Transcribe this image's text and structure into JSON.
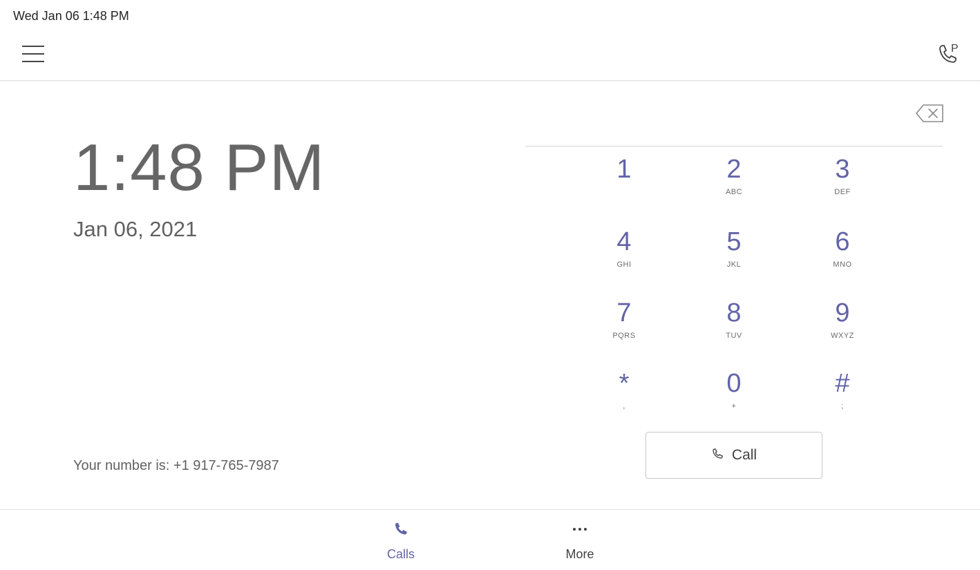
{
  "status_bar": {
    "datetime": "Wed Jan 06  1:48 PM"
  },
  "header": {
    "menu_icon": "hamburger-menu-icon",
    "park_icon": "call-park-icon"
  },
  "clock": {
    "time": "1:48 PM",
    "date": "Jan 06, 2021",
    "my_number": "Your number is: +1 917-765-7987"
  },
  "dialpad": {
    "backspace_icon": "backspace-icon",
    "keys": [
      {
        "digit": "1",
        "letters": ""
      },
      {
        "digit": "2",
        "letters": "ABC"
      },
      {
        "digit": "3",
        "letters": "DEF"
      },
      {
        "digit": "4",
        "letters": "GHI"
      },
      {
        "digit": "5",
        "letters": "JKL"
      },
      {
        "digit": "6",
        "letters": "MNO"
      },
      {
        "digit": "7",
        "letters": "PQRS"
      },
      {
        "digit": "8",
        "letters": "TUV"
      },
      {
        "digit": "9",
        "letters": "WXYZ"
      },
      {
        "digit": "*",
        "letters": ","
      },
      {
        "digit": "0",
        "letters": "+"
      },
      {
        "digit": "#",
        "letters": ";"
      }
    ],
    "call_label": "Call"
  },
  "bottom_nav": {
    "items": [
      {
        "label": "Calls",
        "icon": "phone-icon",
        "active": true
      },
      {
        "label": "More",
        "icon": "more-dots-icon",
        "active": false
      }
    ]
  },
  "colors": {
    "accent": "#6264a7",
    "text_secondary": "#616161",
    "clock_text": "#666666",
    "divider": "#e1e1e1"
  }
}
